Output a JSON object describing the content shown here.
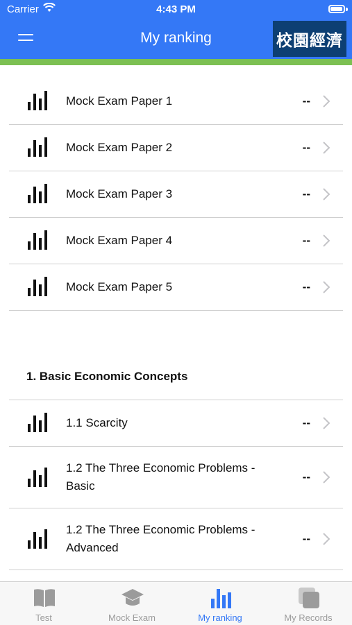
{
  "status_bar": {
    "carrier": "Carrier",
    "time": "4:43 PM"
  },
  "nav": {
    "title": "My ranking",
    "logo_text": "校園經濟"
  },
  "mock_exams": [
    {
      "label": "Mock Exam Paper 1",
      "score": "--"
    },
    {
      "label": "Mock Exam Paper 2",
      "score": "--"
    },
    {
      "label": "Mock Exam Paper 3",
      "score": "--"
    },
    {
      "label": "Mock Exam Paper 4",
      "score": "--"
    },
    {
      "label": "Mock Exam Paper 5",
      "score": "--"
    }
  ],
  "section": {
    "title": "1. Basic Economic Concepts",
    "items": [
      {
        "label_line1": "1.1 Scarcity",
        "label_line2": "",
        "score": "--"
      },
      {
        "label_line1": "1.2 The Three Economic Problems -",
        "label_line2": "Basic",
        "score": "--"
      },
      {
        "label_line1": "1.2 The Three Economic Problems -",
        "label_line2": "Advanced",
        "score": "--"
      }
    ]
  },
  "tabs": [
    {
      "label": "Test",
      "icon": "book-icon",
      "active": false
    },
    {
      "label": "Mock Exam",
      "icon": "graduation-cap-icon",
      "active": false
    },
    {
      "label": "My ranking",
      "icon": "bar-chart-icon",
      "active": true
    },
    {
      "label": "My Records",
      "icon": "records-icon",
      "active": false
    }
  ],
  "colors": {
    "accent": "#3478f6",
    "green_bar": "#7cc052",
    "inactive": "#9b9b9b"
  }
}
